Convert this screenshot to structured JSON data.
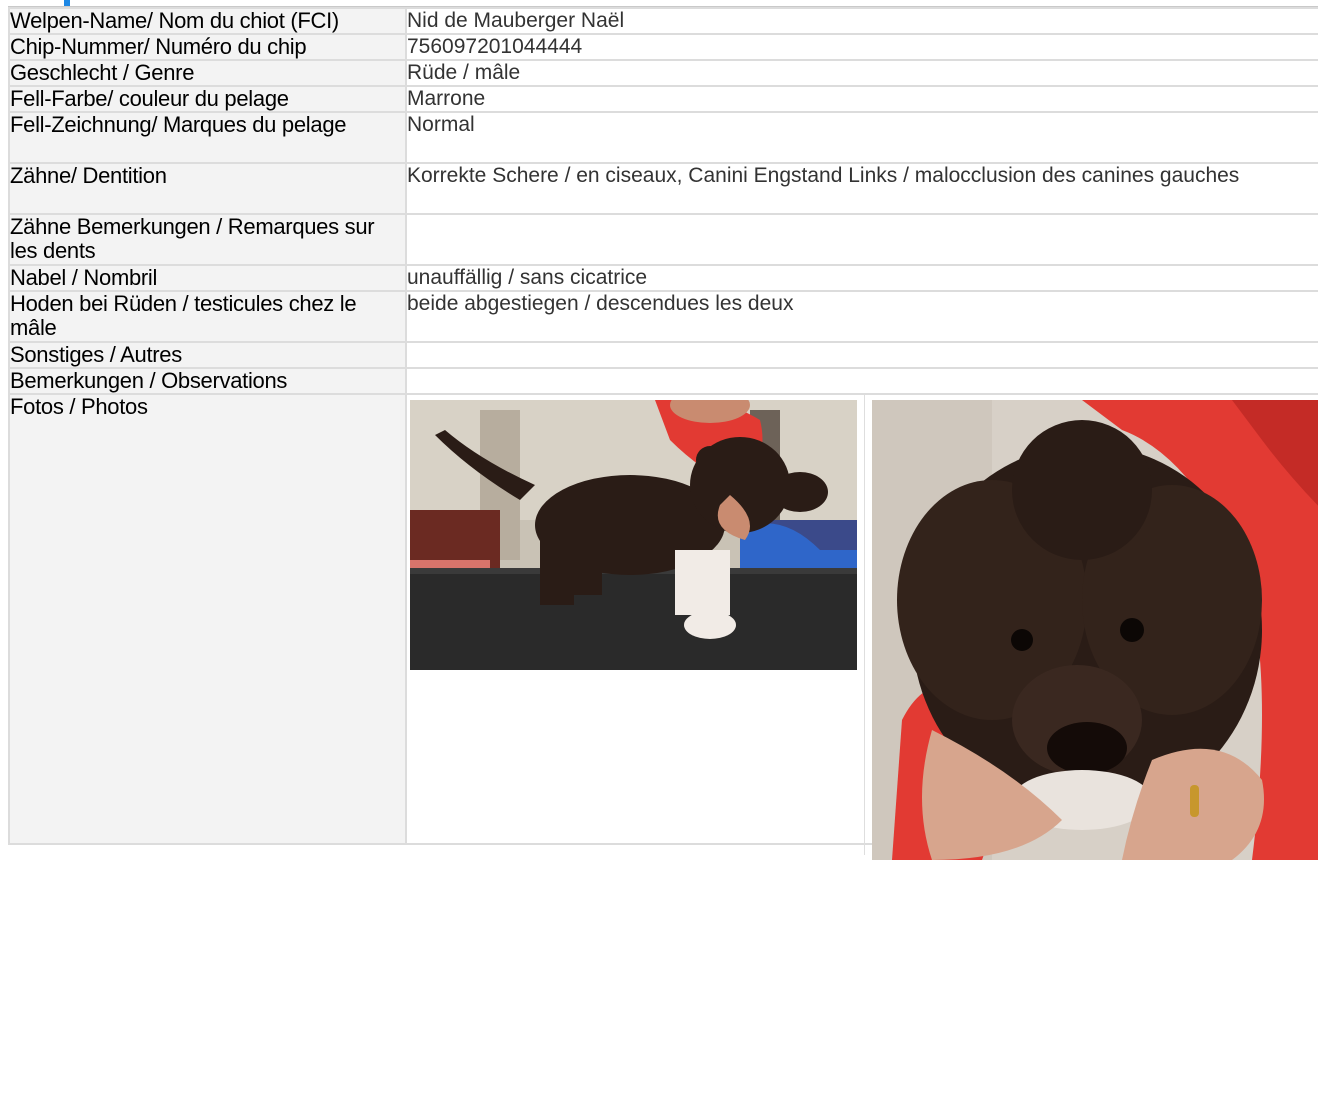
{
  "rows": [
    {
      "label": "Welpen-Name/ Nom du chiot (FCI)",
      "value": "Nid de Mauberger Naël"
    },
    {
      "label": "Chip-Nummer/ Numéro du chip",
      "value": "756097201044444"
    },
    {
      "label": "Geschlecht / Genre",
      "value": "Rüde / mâle"
    },
    {
      "label": "Fell-Farbe/ couleur du pelage",
      "value": "Marrone"
    },
    {
      "label": "Fell-Zeichnung/ Marques du pelage",
      "value": "Normal"
    },
    {
      "label": "Zähne/ Dentition",
      "value": "Korrekte Schere / en ciseaux, Canini Engstand Links / malocclusion des canines gauches"
    },
    {
      "label": "Zähne Bemerkungen / Remarques sur les dents",
      "value": ""
    },
    {
      "label": "Nabel / Nombril",
      "value": "unauffällig / sans cicatrice"
    },
    {
      "label": "Hoden bei Rüden / testicules chez le mâle",
      "value": "beide abgestiegen / descendues les deux"
    },
    {
      "label": "Sonstiges / Autres",
      "value": ""
    },
    {
      "label": "Bemerkungen / Observations",
      "value": ""
    }
  ],
  "photos": {
    "label": "Fotos / Photos",
    "images": [
      {
        "subject": "brown curly puppy standing on grooming table, side view"
      },
      {
        "subject": "close-up of brown curly puppy face held in hands"
      }
    ]
  },
  "colors": {
    "accent": "#1e88e5",
    "label_bg": "#f3f3f3",
    "border": "#dcdcdc",
    "puppy_coat": "#2a1c16",
    "sweater_red": "#e23a33"
  }
}
